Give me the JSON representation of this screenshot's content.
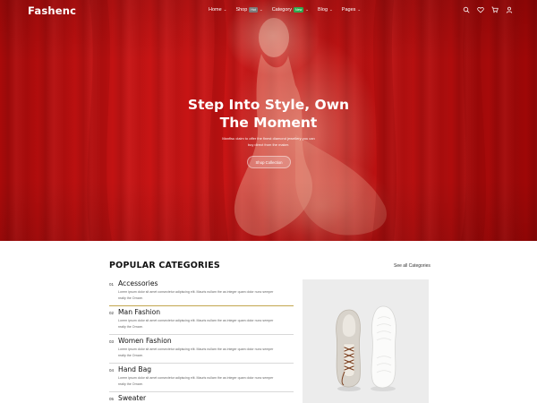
{
  "header": {
    "logo": "Fashenc",
    "nav": [
      {
        "label": "Home",
        "badge": ""
      },
      {
        "label": "Shop",
        "badge": "Hot"
      },
      {
        "label": "Category",
        "badge": "New"
      },
      {
        "label": "Blog",
        "badge": ""
      },
      {
        "label": "Pages",
        "badge": ""
      }
    ],
    "tools": [
      "search-icon",
      "heart-icon",
      "cart-icon",
      "user-icon"
    ]
  },
  "hero": {
    "title_line1": "Step Into Style, Own",
    "title_line2": "The Moment",
    "subtitle_line1": "Manfisu claim to offer the finest diamond jewellery you can",
    "subtitle_line2": "buy direct from the maker.",
    "button": "Shop Collection"
  },
  "categories": {
    "heading": "POPULAR CATEGORIES",
    "see_all": "See all Categories",
    "items": [
      {
        "num": "01",
        "name": "Accessories",
        "desc_line1": "Lorem ipsum dolor sit amet consectetur adipiscing elit. Mauris nullam the as integer quam dolor nunc semper",
        "desc_line2": "realty the Ornare."
      },
      {
        "num": "02",
        "name": "Man Fashion",
        "desc_line1": "Lorem ipsum dolor sit amet consectetur adipiscing elit. Mauris nullam the as integer quam dolor nunc semper",
        "desc_line2": "realty the Ornare."
      },
      {
        "num": "03",
        "name": "Women Fashion",
        "desc_line1": "Lorem ipsum dolor sit amet consectetur adipiscing elit. Mauris nullam the as integer quam dolor nunc semper",
        "desc_line2": "realty the Ornare."
      },
      {
        "num": "04",
        "name": "Hand Bag",
        "desc_line1": "Lorem ipsum dolor sit amet consectetur adipiscing elit. Mauris nullam the as integer quam dolor nunc semper",
        "desc_line2": "realty the Ornare."
      },
      {
        "num": "05",
        "name": "Sweater",
        "desc_line1": "",
        "desc_line2": ""
      }
    ]
  },
  "colors": {
    "hero_red": "#c81414",
    "active_underline": "#c3a64f",
    "badge_hot": "#7a7a7a",
    "badge_new": "#2fa84f"
  }
}
